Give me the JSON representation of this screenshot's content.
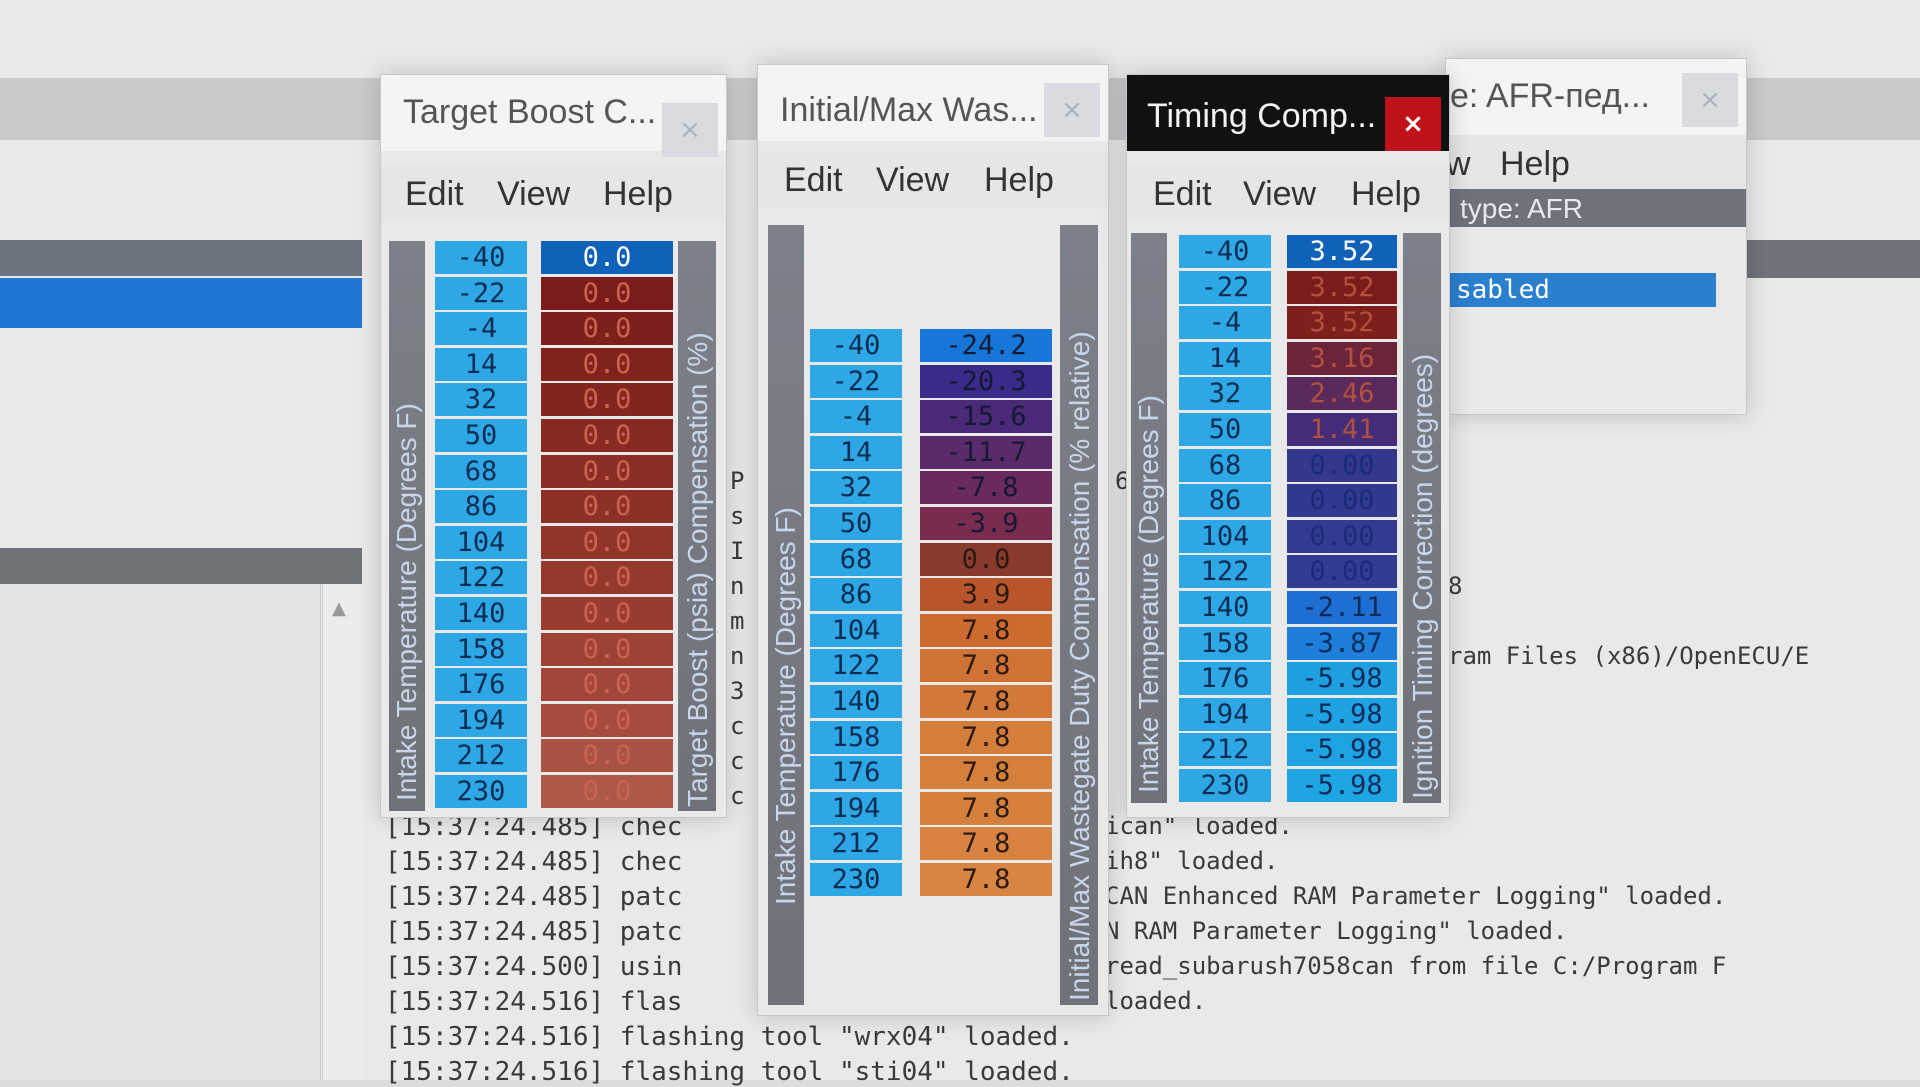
{
  "console": {
    "lines": [
      {
        "time": "[15:37:24.485]",
        "text": " chec"
      },
      {
        "time": "[15:37:24.485]",
        "text": " chec"
      },
      {
        "time": "[15:37:24.485]",
        "text": " patc"
      },
      {
        "time": "[15:37:24.485]",
        "text": " patc"
      },
      {
        "time": "[15:37:24.500]",
        "text": " usin"
      },
      {
        "time": "[15:37:24.516]",
        "text": " flas"
      },
      {
        "time": "[15:37:24.516]",
        "text": " flashing tool \"wrx04\" loaded."
      },
      {
        "time": "[15:37:24.516]",
        "text": " flashing tool \"sti04\" loaded."
      }
    ],
    "right_fragments": [
      "ican\" loaded.",
      "ih8\" loaded.",
      "CAN Enhanced RAM Parameter Logging\" loaded.",
      "N RAM Parameter Logging\" loaded.",
      "read_subarush7058can from file C:/Program F",
      "loaded."
    ],
    "path_fragment": "ram Files (x86)/OpenECU/E",
    "digit_fragment": "8",
    "six_fragment": "6",
    "left_fragments": [
      "P",
      "s",
      "I",
      "n",
      "m",
      "n",
      "3",
      "c",
      "c",
      "c"
    ]
  },
  "windows": {
    "target_boost": {
      "title": "Target Boost C...",
      "close": "×",
      "menu": [
        "Edit",
        "View",
        "Help"
      ],
      "x_label": "Intake Temperature (Degrees F)",
      "y_label": "Target Boost (psia) Compensation (%)",
      "x_values": [
        "-40",
        "-22",
        "-4",
        "14",
        "32",
        "50",
        "68",
        "86",
        "104",
        "122",
        "140",
        "158",
        "176",
        "194",
        "212",
        "230"
      ],
      "y_values": [
        "0.0",
        "0.0",
        "0.0",
        "0.0",
        "0.0",
        "0.0",
        "0.0",
        "0.0",
        "0.0",
        "0.0",
        "0.0",
        "0.0",
        "0.0",
        "0.0",
        "0.0",
        "0.0"
      ]
    },
    "wastegate": {
      "title": "Initial/Max Was...",
      "close": "×",
      "menu": [
        "Edit",
        "View",
        "Help"
      ],
      "x_label": "Intake Temperature (Degrees F)",
      "y_label": "Initial/Max Wastegate Duty Compensation (% relative)",
      "x_values": [
        "-40",
        "-22",
        "-4",
        "14",
        "32",
        "50",
        "68",
        "86",
        "104",
        "122",
        "140",
        "158",
        "176",
        "194",
        "212",
        "230"
      ],
      "y_values": [
        "-24.2",
        "-20.3",
        "-15.6",
        "-11.7",
        "-7.8",
        "-3.9",
        "0.0",
        "3.9",
        "7.8",
        "7.8",
        "7.8",
        "7.8",
        "7.8",
        "7.8",
        "7.8",
        "7.8"
      ]
    },
    "timing": {
      "title": "Timing Comp...",
      "close": "×",
      "menu": [
        "Edit",
        "View",
        "Help"
      ],
      "x_label": "Intake Temperature (Degrees F)",
      "y_label": "Ignition Timing Correction (degrees)",
      "x_values": [
        "-40",
        "-22",
        "-4",
        "14",
        "32",
        "50",
        "68",
        "86",
        "104",
        "122",
        "140",
        "158",
        "176",
        "194",
        "212",
        "230"
      ],
      "y_values": [
        "3.52",
        "3.52",
        "3.52",
        "3.16",
        "2.46",
        "1.41",
        "0.00",
        "0.00",
        "0.00",
        "0.00",
        "-2.11",
        "-3.87",
        "-5.98",
        "-5.98",
        "-5.98",
        "-5.98"
      ]
    },
    "afr": {
      "title": "e: AFR-пед...",
      "close": "×",
      "menu": [
        "w",
        "Help"
      ],
      "type_text": "type: AFR",
      "disabled_text": "sabled"
    }
  },
  "colors": {
    "x_cell": "#2ea7e6",
    "boost_cells": [
      "#0f62b8",
      "#7a1d1a",
      "#7d201b",
      "#80231d",
      "#83261f",
      "#872a22",
      "#8a2d24",
      "#8d3127",
      "#91352a",
      "#95392d",
      "#993d31",
      "#9d4235",
      "#a14739",
      "#a54c3e",
      "#aa5243",
      "#ae5848"
    ],
    "wastegate_cells": [
      "#1677d8",
      "#3a2a8a",
      "#4a2a78",
      "#5a2a6a",
      "#6a2a5c",
      "#7a2c4e",
      "#8a3a2c",
      "#b8552a",
      "#cc6a30",
      "#d07236",
      "#d27838",
      "#d47e3c",
      "#d57f3c",
      "#d6803e",
      "#d78240",
      "#d88442"
    ],
    "timing_cells": [
      "#0f62b8",
      "#7a1d1a",
      "#7d201b",
      "#6c2438",
      "#5a2a5c",
      "#452c78",
      "#33388d",
      "#33398e",
      "#323b90",
      "#313c92",
      "#1f6fd2",
      "#1d7fd9",
      "#1ea0e0",
      "#1ea2e2",
      "#1ea4e3",
      "#1ea6e4"
    ]
  }
}
